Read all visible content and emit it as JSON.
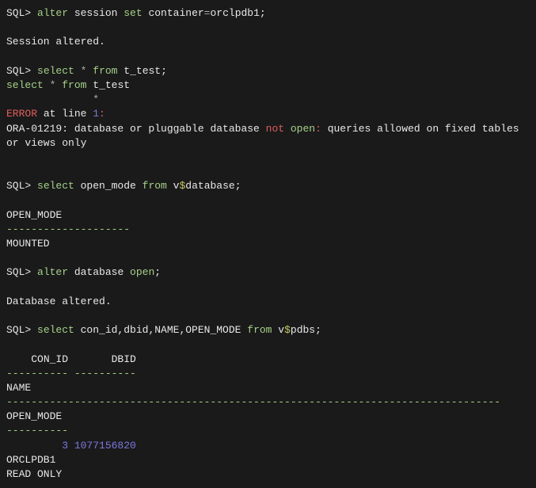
{
  "terminal": {
    "lines": [
      {
        "segments": [
          {
            "text": "SQL> ",
            "cls": "white"
          },
          {
            "text": "alter",
            "cls": "green"
          },
          {
            "text": " session ",
            "cls": "white"
          },
          {
            "text": "set",
            "cls": "green"
          },
          {
            "text": " container",
            "cls": "white"
          },
          {
            "text": "=",
            "cls": "gray"
          },
          {
            "text": "orclpdb1;",
            "cls": "white"
          }
        ]
      },
      {
        "segments": [
          {
            "text": "",
            "cls": "white"
          }
        ]
      },
      {
        "segments": [
          {
            "text": "Session altered.",
            "cls": "white"
          }
        ]
      },
      {
        "segments": [
          {
            "text": "",
            "cls": "white"
          }
        ]
      },
      {
        "segments": [
          {
            "text": "SQL> ",
            "cls": "white"
          },
          {
            "text": "select",
            "cls": "green"
          },
          {
            "text": " ",
            "cls": "white"
          },
          {
            "text": "*",
            "cls": "gray"
          },
          {
            "text": " ",
            "cls": "white"
          },
          {
            "text": "from",
            "cls": "green"
          },
          {
            "text": " t_test;",
            "cls": "white"
          }
        ]
      },
      {
        "segments": [
          {
            "text": "select",
            "cls": "green"
          },
          {
            "text": " ",
            "cls": "white"
          },
          {
            "text": "*",
            "cls": "gray"
          },
          {
            "text": " ",
            "cls": "white"
          },
          {
            "text": "from",
            "cls": "green"
          },
          {
            "text": " t_test",
            "cls": "white"
          }
        ]
      },
      {
        "segments": [
          {
            "text": "              ",
            "cls": "white"
          },
          {
            "text": "*",
            "cls": "gray"
          }
        ]
      },
      {
        "segments": [
          {
            "text": "ERROR",
            "cls": "red"
          },
          {
            "text": " at line ",
            "cls": "white"
          },
          {
            "text": "1",
            "cls": "blue"
          },
          {
            "text": ":",
            "cls": "red"
          }
        ]
      },
      {
        "segments": [
          {
            "text": "ORA-01219: database or pluggable database ",
            "cls": "white"
          },
          {
            "text": "not",
            "cls": "red"
          },
          {
            "text": " ",
            "cls": "white"
          },
          {
            "text": "open",
            "cls": "green"
          },
          {
            "text": ": ",
            "cls": "red"
          },
          {
            "text": "queries allowed on fixed tables or views only",
            "cls": "white"
          }
        ]
      },
      {
        "segments": [
          {
            "text": "",
            "cls": "white"
          }
        ]
      },
      {
        "segments": [
          {
            "text": "",
            "cls": "white"
          }
        ]
      },
      {
        "segments": [
          {
            "text": "SQL> ",
            "cls": "white"
          },
          {
            "text": "select",
            "cls": "green"
          },
          {
            "text": " open_mode ",
            "cls": "white"
          },
          {
            "text": "from",
            "cls": "green"
          },
          {
            "text": " v",
            "cls": "white"
          },
          {
            "text": "$",
            "cls": "yellow"
          },
          {
            "text": "database;",
            "cls": "white"
          }
        ]
      },
      {
        "segments": [
          {
            "text": "",
            "cls": "white"
          }
        ]
      },
      {
        "segments": [
          {
            "text": "OPEN_MODE",
            "cls": "white"
          }
        ]
      },
      {
        "segments": [
          {
            "text": "--------------------",
            "cls": "green"
          }
        ]
      },
      {
        "segments": [
          {
            "text": "MOUNTED",
            "cls": "white"
          }
        ]
      },
      {
        "segments": [
          {
            "text": "",
            "cls": "white"
          }
        ]
      },
      {
        "segments": [
          {
            "text": "SQL> ",
            "cls": "white"
          },
          {
            "text": "alter",
            "cls": "green"
          },
          {
            "text": " database ",
            "cls": "white"
          },
          {
            "text": "open",
            "cls": "green"
          },
          {
            "text": ";",
            "cls": "white"
          }
        ]
      },
      {
        "segments": [
          {
            "text": "",
            "cls": "white"
          }
        ]
      },
      {
        "segments": [
          {
            "text": "Database altered.",
            "cls": "white"
          }
        ]
      },
      {
        "segments": [
          {
            "text": "",
            "cls": "white"
          }
        ]
      },
      {
        "segments": [
          {
            "text": "SQL> ",
            "cls": "white"
          },
          {
            "text": "select",
            "cls": "green"
          },
          {
            "text": " con_id,dbid,NAME,OPEN_MODE ",
            "cls": "white"
          },
          {
            "text": "from",
            "cls": "green"
          },
          {
            "text": " v",
            "cls": "white"
          },
          {
            "text": "$",
            "cls": "yellow"
          },
          {
            "text": "pdbs;",
            "cls": "white"
          }
        ]
      },
      {
        "segments": [
          {
            "text": "",
            "cls": "white"
          }
        ]
      },
      {
        "segments": [
          {
            "text": "    CON_ID       DBID",
            "cls": "white"
          }
        ]
      },
      {
        "segments": [
          {
            "text": "---------- ----------",
            "cls": "green"
          }
        ]
      },
      {
        "segments": [
          {
            "text": "NAME",
            "cls": "white"
          }
        ]
      },
      {
        "segments": [
          {
            "text": "--------------------------------------------------------------------------------",
            "cls": "green"
          }
        ]
      },
      {
        "segments": [
          {
            "text": "OPEN_MODE",
            "cls": "white"
          }
        ]
      },
      {
        "segments": [
          {
            "text": "----------",
            "cls": "green"
          }
        ]
      },
      {
        "segments": [
          {
            "text": "         ",
            "cls": "white"
          },
          {
            "text": "3 1077156820",
            "cls": "blue"
          }
        ]
      },
      {
        "segments": [
          {
            "text": "ORCLPDB1",
            "cls": "white"
          }
        ]
      },
      {
        "segments": [
          {
            "text": "READ ONLY",
            "cls": "white"
          }
        ]
      }
    ]
  }
}
